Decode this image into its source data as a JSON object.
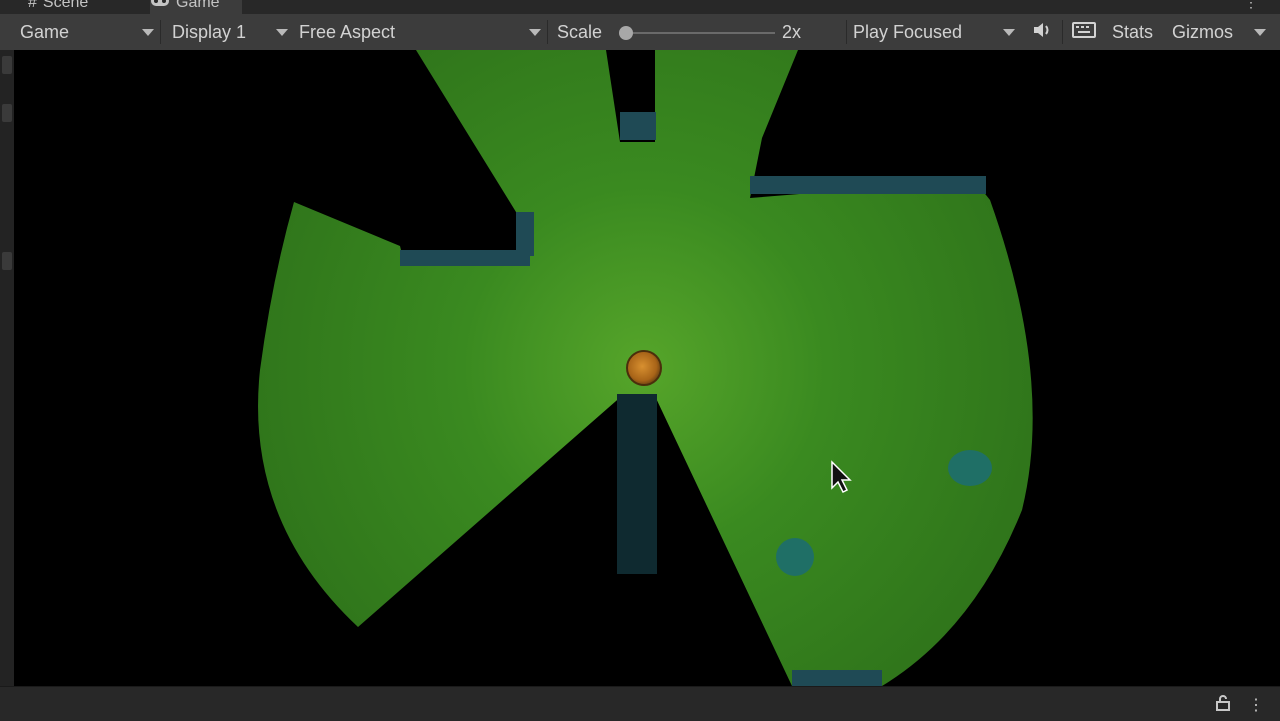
{
  "tabs": [
    {
      "label": "Scene",
      "icon": "grid-icon"
    },
    {
      "label": "Game",
      "icon": "gamepad-icon"
    }
  ],
  "toolbar": {
    "view_dropdown": "Game",
    "display_dropdown": "Display 1",
    "aspect_dropdown": "Free Aspect",
    "scale_label": "Scale",
    "scale_value": "2x",
    "play_mode_dropdown": "Play Focused",
    "stats_label": "Stats",
    "gizmos_label": "Gizmos"
  },
  "colors": {
    "fov_green": "#3f8f22",
    "wall_teal": "#1f4a55",
    "player": "#c87a1e",
    "orb": "#1f6f66"
  }
}
